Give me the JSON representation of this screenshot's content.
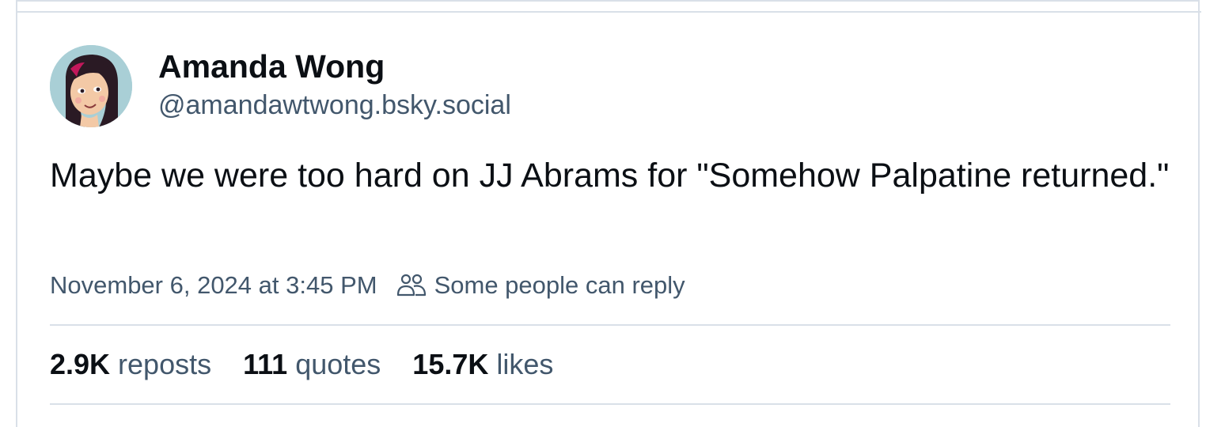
{
  "author": {
    "name": "Amanda Wong",
    "handle": "@amandawtwong.bsky.social"
  },
  "post": {
    "text": "Maybe we were too hard on JJ Abrams for \"Somehow Palpatine returned.\""
  },
  "meta": {
    "timestamp": "November 6, 2024 at 3:45 PM",
    "reply_setting": "Some people can reply",
    "reply_icon": "people-icon"
  },
  "stats": {
    "reposts_count": "2.9K",
    "reposts_label": "reposts",
    "quotes_count": "111",
    "quotes_label": "quotes",
    "likes_count": "15.7K",
    "likes_label": "likes"
  },
  "colors": {
    "text_primary": "#0b0f14",
    "text_secondary": "#42576c",
    "border": "#d9e0e8",
    "avatar_bg": "#a9cfd6"
  }
}
